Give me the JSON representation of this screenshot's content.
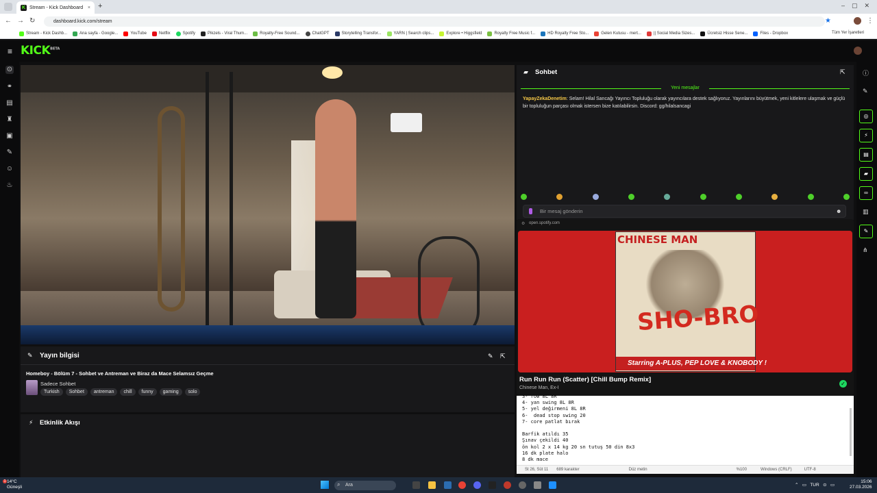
{
  "browser": {
    "tab_title": "Stream - Kick Dashboard",
    "new_tab": "+",
    "url": "dashboard.kick.com/stream",
    "bookmarks": [
      {
        "label": "Stream - Kick Dashb...",
        "color": "#53fc18"
      },
      {
        "label": "Ana sayfa - Google...",
        "color": "#34a853"
      },
      {
        "label": "YouTube",
        "color": "#ff0000"
      },
      {
        "label": "Netflix",
        "color": "#e50914"
      },
      {
        "label": "Spotify",
        "color": "#1ed760"
      },
      {
        "label": "Pikzels - Viral Thum...",
        "color": "#222222"
      },
      {
        "label": "Royalty-Free Sound...",
        "color": "#6cbd45"
      },
      {
        "label": "ChatGPT",
        "color": "#444444"
      },
      {
        "label": "Storytelling Transfor...",
        "color": "#2b3a67"
      },
      {
        "label": "YARN | Search clips...",
        "color": "#9be564"
      },
      {
        "label": "Explore • Higgsfield",
        "color": "#c6f432"
      },
      {
        "label": "Royalty Free Music f...",
        "color": "#7bc043"
      },
      {
        "label": "HD Royalty Free Sto...",
        "color": "#1b75bb"
      },
      {
        "label": "Gelen Kutusu - mert...",
        "color": "#ea4335"
      },
      {
        "label": "|| Social Media Sizes...",
        "color": "#e03a3a"
      },
      {
        "label": "Ücretsiz Hisse Sene...",
        "color": "#111111"
      },
      {
        "label": "Files - Dropbox",
        "color": "#0061fe"
      }
    ],
    "all_bookmarks": "Tüm Yer İşaretleri"
  },
  "kick": {
    "logo": "KICK",
    "logo_badge": "BETA",
    "stream_info": {
      "section_title": "Yayın bilgisi",
      "title": "Homeboy - Bölüm 7 - Sohbet ve Antreman ve Biraz da Mace Selamsız Geçme",
      "category": "Sadece Sohbet",
      "tags": [
        "Turkish",
        "Sohbet",
        "antreman",
        "chill",
        "funny",
        "gaming",
        "solo"
      ]
    },
    "activity": {
      "section_title": "Etkinlik Akışı"
    },
    "chat": {
      "title": "Sohbet",
      "new_messages": "Yeni mesajlar",
      "messages": [
        {
          "user": "YapayZekaDenetim",
          "text": "Selam! Hilal Sancağı Yayıncı Topluluğu olarak yayıncılara destek sağlıyoruz. Yayınlarını büyütmek, yeni kitlelere ulaşmak ve güçlü bir topluluğun parçası olmak istersen bize katılabilirsin. Discord: gg/hilalsancagi"
        }
      ],
      "input_placeholder": "Bir mesaj gönderin"
    }
  },
  "spotify": {
    "source": "open.spotify.com",
    "album_top": "CHINESE MAN",
    "album_title": "SHO-BRO",
    "album_bottom": "Starring A-PLUS, PEP LOVE & KNOBODY !",
    "song": "Run Run Run (Scatter) [Chill Bump Remix]",
    "artist": "Chinese Man, Ex-I",
    "accent": "#c91f1f"
  },
  "notepad": {
    "lines": [
      "3- row 8L 8R",
      "4- yan swing 8L 8R",
      "5- yel değirmeni 8L 8R",
      "6-  dead stop swing 20",
      "7- core patlat bırak",
      "",
      "Barfik atıldı 35",
      "Şınav çekildi 40",
      "ön kol 2 x 14 kg 20 sn tutuş 50 din 8x3",
      "16 dk plate halo",
      "8 dk mace"
    ],
    "status": {
      "position": "St 26, Süt 11",
      "chars": "689 karakter",
      "mode": "Düz metin",
      "zoom": "%100",
      "eol": "Windows (CRLF)",
      "encoding": "UTF-8"
    }
  },
  "taskbar": {
    "temp": "14°C",
    "weather": "Güneşli",
    "search": "Ara",
    "lang": "TUR",
    "time": "15:06",
    "date": "27.03.2026",
    "notif_count": "1"
  }
}
